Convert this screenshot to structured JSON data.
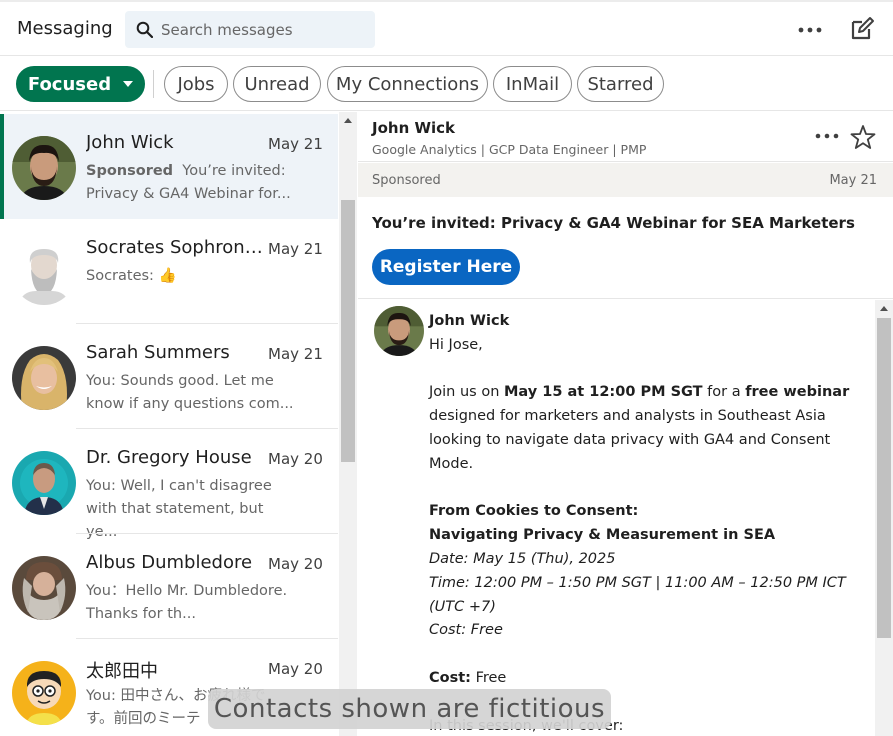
{
  "header": {
    "title": "Messaging",
    "search_placeholder": "Search messages",
    "more_icon": "more-horizontal-icon",
    "compose_icon": "compose-icon"
  },
  "filters": {
    "focused": "Focused",
    "items": [
      "Jobs",
      "Unread",
      "My Connections",
      "InMail",
      "Starred"
    ]
  },
  "conversations": [
    {
      "name": "John Wick",
      "date": "May 21",
      "sponsored": "Sponsored",
      "snippet": "You’re invited: Privacy & GA4 Webinar for...",
      "active": true
    },
    {
      "name": "Socrates Sophronisc...",
      "date": "May 21",
      "snippet": "Socrates: 👍"
    },
    {
      "name": "Sarah Summers",
      "date": "May 21",
      "snippet": "You: Sounds good. Let me know if any questions com..."
    },
    {
      "name": "Dr. Gregory House",
      "date": "May 20",
      "snippet": "You: Well, I can't disagree with that statement, but ye..."
    },
    {
      "name": "Albus Dumbledore",
      "date": "May 20",
      "snippet": "You：Hello Mr. Dumbledore. Thanks for th..."
    },
    {
      "name": "太郎田中",
      "date": "May 20",
      "snippet": "You: 田中さん、お疲れ様で す。前回のミーテ"
    }
  ],
  "thread": {
    "name": "John Wick",
    "subtitle": "Google Analytics | GCP Data Engineer | PMP",
    "sponsored_label": "Sponsored",
    "sponsored_date": "May 21",
    "invite_title": "You’re invited: Privacy & GA4 Webinar for SEA Marketers",
    "register_label": "Register Here",
    "message": {
      "sender": "John Wick",
      "greeting": "Hi Jose,",
      "intro_pre": "Join us on ",
      "intro_date": "May 15 at 12:00 PM SGT",
      "intro_mid": " for a ",
      "intro_free": "free webinar",
      "intro_post": " designed for marketers and analysts in Southeast Asia looking to navigate data privacy with GA4 and Consent Mode.",
      "heading1": "From Cookies to Consent:",
      "heading2": "Navigating Privacy & Measurement in SEA",
      "date_line": "Date: May 15 (Thu), 2025",
      "time_line": "Time: 12:00 PM – 1:50 PM SGT | 11:00 AM – 12:50 PM ICT (UTC +7)",
      "cost_line": "Cost: Free",
      "cost_label": "Cost:",
      "cost_value": " Free",
      "session_line": "In this session, we'll cover:"
    }
  },
  "overlay": {
    "caption": "Contacts shown are fictitious"
  },
  "colors": {
    "accent_green": "#01754f",
    "link_blue": "#0a66c2",
    "search_bg": "#edf3f8"
  }
}
